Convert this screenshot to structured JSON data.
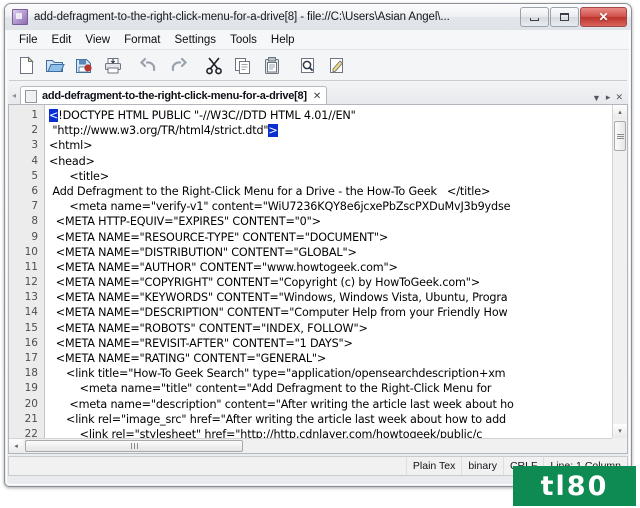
{
  "window": {
    "title": "add-defragment-to-the-right-click-menu-for-a-drive[8] - file://C:\\Users\\Asian Angel\\...",
    "app_icon": "notepad-plus-icon",
    "buttons": {
      "minimize": "minimize-icon",
      "maximize": "maximize-icon",
      "close_label": "✕"
    }
  },
  "menu": {
    "items": [
      {
        "label": "File"
      },
      {
        "label": "Edit"
      },
      {
        "label": "View"
      },
      {
        "label": "Format"
      },
      {
        "label": "Settings"
      },
      {
        "label": "Tools"
      },
      {
        "label": "Help"
      }
    ]
  },
  "toolbar": {
    "buttons": [
      {
        "name": "new-file-icon"
      },
      {
        "name": "open-file-icon"
      },
      {
        "name": "save-file-icon"
      },
      {
        "name": "print-icon"
      },
      {
        "name": "undo-icon"
      },
      {
        "name": "redo-icon"
      },
      {
        "name": "cut-icon"
      },
      {
        "name": "copy-icon"
      },
      {
        "name": "paste-icon"
      },
      {
        "name": "find-icon"
      },
      {
        "name": "find-replace-icon"
      }
    ]
  },
  "tab_bar": {
    "scroll_left": "◂",
    "tab_label": "add-defragment-to-the-right-click-menu-for-a-drive[8]",
    "tab_close": "✕",
    "right_controls": {
      "dropdown": "▼",
      "next": "▸",
      "close": "✕"
    }
  },
  "editor": {
    "lines": [
      {
        "n": "1",
        "pre": "",
        "brk": "<",
        "post": "!DOCTYPE HTML PUBLIC \"-//W3C//DTD HTML 4.01//EN\""
      },
      {
        "n": "2",
        "pre": " \"http://www.w3.org/TR/html4/strict.dtd\"",
        "brk": ">",
        "post": ""
      },
      {
        "n": "3",
        "text": "<html>"
      },
      {
        "n": "4",
        "text": "<head>"
      },
      {
        "n": "5",
        "text": "      <title>"
      },
      {
        "n": "6",
        "text": " Add Defragment to the Right-Click Menu for a Drive - the How-To Geek   </title>"
      },
      {
        "n": "7",
        "text": "      <meta name=\"verify-v1\" content=\"WiU7236KQY8e6jcxePbZscPXDuMvJ3b9ydse"
      },
      {
        "n": "8",
        "text": "  <META HTTP-EQUIV=\"EXPIRES\" CONTENT=\"0\">"
      },
      {
        "n": "9",
        "text": "  <META NAME=\"RESOURCE-TYPE\" CONTENT=\"DOCUMENT\">"
      },
      {
        "n": "10",
        "text": "  <META NAME=\"DISTRIBUTION\" CONTENT=\"GLOBAL\">"
      },
      {
        "n": "11",
        "text": "  <META NAME=\"AUTHOR\" CONTENT=\"www.howtogeek.com\">"
      },
      {
        "n": "12",
        "text": "  <META NAME=\"COPYRIGHT\" CONTENT=\"Copyright (c) by HowToGeek.com\">"
      },
      {
        "n": "13",
        "text": "  <META NAME=\"KEYWORDS\" CONTENT=\"Windows, Windows Vista, Ubuntu, Progra"
      },
      {
        "n": "14",
        "text": "  <META NAME=\"DESCRIPTION\" CONTENT=\"Computer Help from your Friendly How"
      },
      {
        "n": "15",
        "text": "  <META NAME=\"ROBOTS\" CONTENT=\"INDEX, FOLLOW\">"
      },
      {
        "n": "16",
        "text": "  <META NAME=\"REVISIT-AFTER\" CONTENT=\"1 DAYS\">"
      },
      {
        "n": "17",
        "text": "  <META NAME=\"RATING\" CONTENT=\"GENERAL\">"
      },
      {
        "n": "18",
        "text": "     <link title=\"How-To Geek Search\" type=\"application/opensearchdescription+xm"
      },
      {
        "n": "19",
        "text": "         <meta name=\"title\" content=\"Add Defragment to the Right-Click Menu for"
      },
      {
        "n": "20",
        "text": "      <meta name=\"description\" content=\"After writing the article last week about ho"
      },
      {
        "n": "21",
        "text": "     <link rel=\"image_src\" href=\"After writing the article last week about how to add"
      },
      {
        "n": "22",
        "text": "         <link rel=\"stylesheet\" href=\"http://http.cdnlayer.com/howtogeek/public/c"
      }
    ],
    "scroll": {
      "up_arrow": "▴",
      "down_arrow": "▾",
      "left_arrow": "◂"
    }
  },
  "status_bar": {
    "cells": [
      {
        "label": "Plain Tex"
      },
      {
        "label": "binary"
      },
      {
        "label": "CRLF"
      },
      {
        "label": "Line: 1  Column"
      }
    ]
  },
  "watermark": {
    "text": "tl80",
    "color": "#0e8a53"
  }
}
